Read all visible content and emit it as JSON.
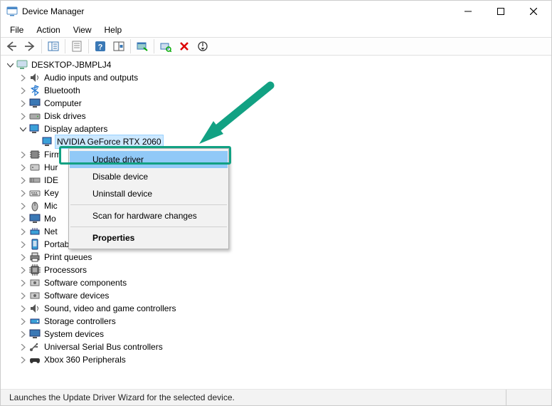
{
  "window": {
    "title": "Device Manager"
  },
  "menu": {
    "file": "File",
    "action": "Action",
    "view": "View",
    "help": "Help"
  },
  "tree": {
    "root": "DESKTOP-JBMPLJ4",
    "audio": "Audio inputs and outputs",
    "bluetooth": "Bluetooth",
    "computer": "Computer",
    "diskdrives": "Disk drives",
    "display": "Display adapters",
    "nvidia": "NVIDIA GeForce RTX 2060",
    "firmware": "Firmware",
    "hid": "Human Interface Devices",
    "ide": "IDE ATA/ATAPI controllers",
    "keyboards": "Keyboards",
    "mice": "Mice and other pointing devices",
    "monitors": "Monitors",
    "netadapters": "Network adapters",
    "portable": "Portable Devices",
    "printqueues": "Print queues",
    "processors": "Processors",
    "swcomp": "Software components",
    "swdev": "Software devices",
    "sound": "Sound, video and game controllers",
    "storage": "Storage controllers",
    "sysdev": "System devices",
    "usb": "Universal Serial Bus controllers",
    "xbox": "Xbox 360 Peripherals",
    "firmware_trunc": "Firm",
    "hid_trunc": "Hur",
    "ide_trunc": "IDE",
    "keyboards_trunc": "Key",
    "mice_trunc": "Mic",
    "monitors_trunc": "Mo",
    "netadapters_trunc": "Net"
  },
  "context_menu": {
    "update": "Update driver",
    "disable": "Disable device",
    "uninstall": "Uninstall device",
    "scan": "Scan for hardware changes",
    "properties": "Properties"
  },
  "statusbar": {
    "text": "Launches the Update Driver Wizard for the selected device."
  }
}
